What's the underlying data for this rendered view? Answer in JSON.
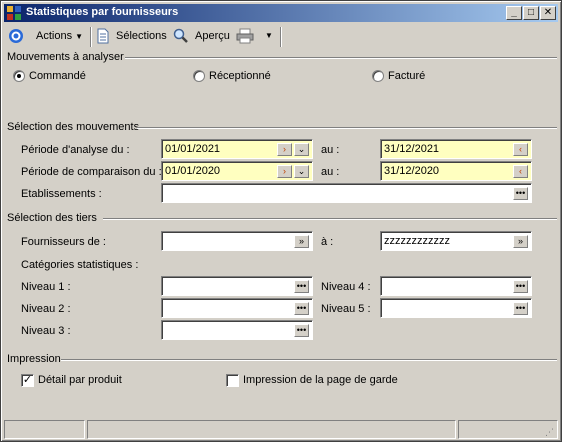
{
  "window": {
    "title": "Statistiques par fournisseurs",
    "minimize": "_",
    "maximize": "□",
    "close": "✕"
  },
  "toolbar": {
    "actions_label": "Actions",
    "selections_label": "Sélections",
    "apercu_label": "Aperçu"
  },
  "mouvements": {
    "section_label": "Mouvements à analyser",
    "options": [
      "Commandé",
      "Réceptionné",
      "Facturé"
    ],
    "selected": "Commandé"
  },
  "selection_mouvements": {
    "section_label": "Sélection des mouvements",
    "periode_analyse_label": "Période d'analyse du :",
    "periode_analyse_from": "01/01/2021",
    "periode_analyse_au_label": "au :",
    "periode_analyse_to": "31/12/2021",
    "periode_comparaison_label": "Période de comparaison du :",
    "periode_comparaison_from": "01/01/2020",
    "periode_comparaison_au_label": "au :",
    "periode_comparaison_to": "31/12/2020",
    "etablissements_label": "Etablissements :",
    "etablissements_value": ""
  },
  "selection_tiers": {
    "section_label": "Sélection des tiers",
    "fournisseurs_label": "Fournisseurs de :",
    "fournisseurs_from": "",
    "fournisseurs_a_label": "à :",
    "fournisseurs_to": "zzzzzzzzzzzz",
    "categories_label": "Catégories statistiques :",
    "niveau1_label": "Niveau 1 :",
    "niveau2_label": "Niveau 2 :",
    "niveau3_label": "Niveau 3 :",
    "niveau4_label": "Niveau 4 :",
    "niveau5_label": "Niveau 5 :"
  },
  "impression": {
    "section_label": "Impression",
    "detail_produit_label": "Détail par produit",
    "detail_produit_checked": true,
    "page_garde_label": "Impression de la page de garde",
    "page_garde_checked": false
  },
  "icons": {
    "ellipsis": "•••",
    "dropdown": "⌄",
    "calendar_glyph": "‹",
    "check_mark": "✓"
  },
  "colors": {
    "title_start": "#0a246a",
    "title_end": "#a6caf0",
    "date_field_bg": "#ffffc0",
    "window_bg": "#d4d0c8"
  }
}
